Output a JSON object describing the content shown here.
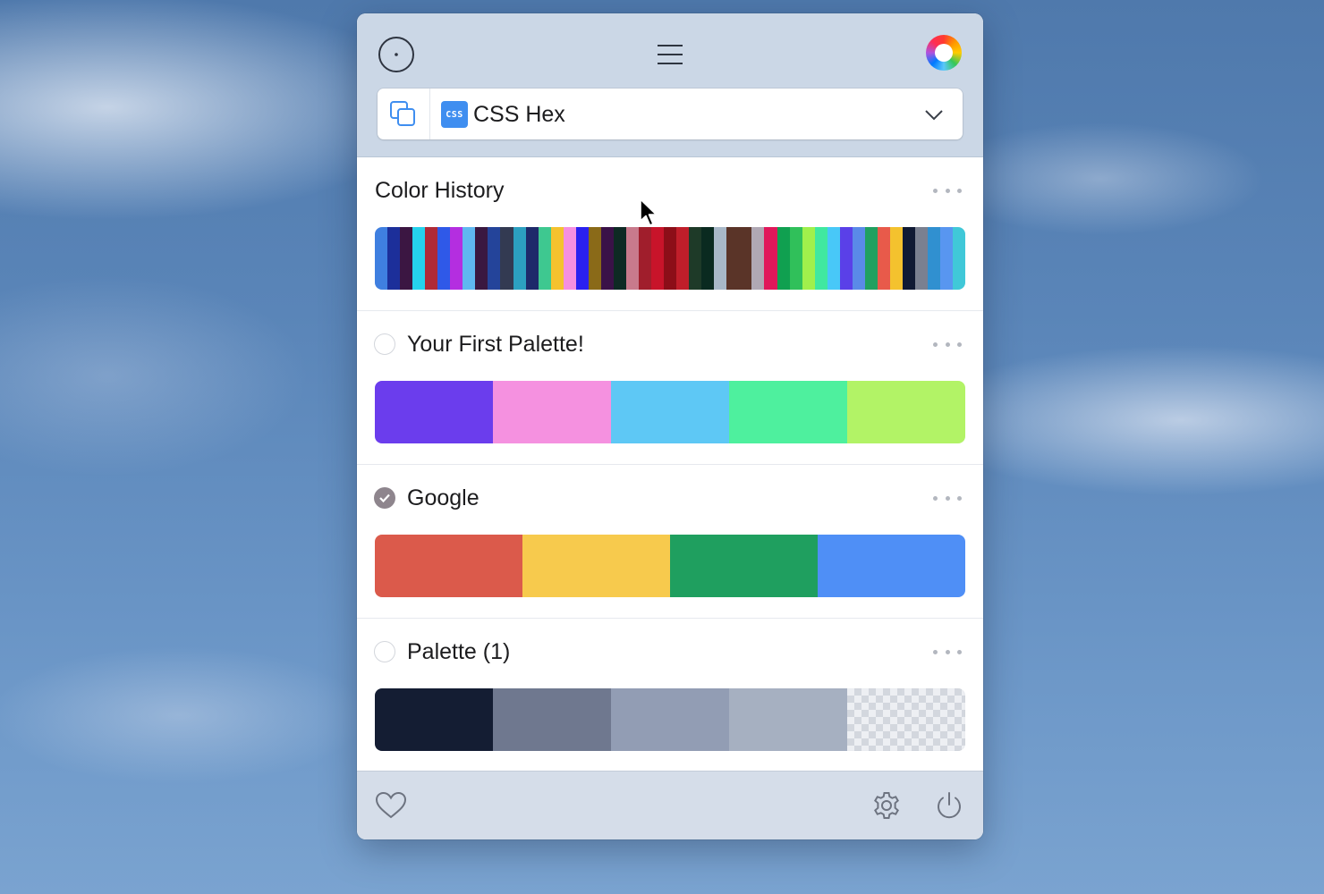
{
  "app": {
    "icons": {
      "eyedropper": "picker-target-icon",
      "menu": "hamburger-menu-icon",
      "color_wheel": "color-wheel-icon",
      "copy": "copy-icon",
      "chevron": "chevron-down-icon",
      "heart": "heart-icon",
      "settings": "gear-icon",
      "power": "power-icon"
    }
  },
  "format_selector": {
    "badge": "CSS",
    "label": "CSS Hex"
  },
  "sections": {
    "history": {
      "title": "Color History",
      "colors": [
        "#3f7fe0",
        "#1c2f9a",
        "#3b1642",
        "#25d2ec",
        "#b02a37",
        "#2f59e8",
        "#b42ee0",
        "#5fb8f0",
        "#3a1840",
        "#24449a",
        "#333a52",
        "#2ca0c0",
        "#1e2a6a",
        "#3ec890",
        "#f4c22e",
        "#f58fe0",
        "#2a20f0",
        "#8a6a18",
        "#3a1248",
        "#0e2a24",
        "#c87a8c",
        "#a01e2c",
        "#c8142a",
        "#8c0e18",
        "#c01e2a",
        "#1e3a28",
        "#0a2a20",
        "#a8b8c8",
        "#5a3428",
        "#5a3428",
        "#b0a8b4",
        "#e0185a",
        "#10a050",
        "#30c05a",
        "#a0f04c",
        "#40e8a0",
        "#48c8f8",
        "#5a40e8",
        "#5a8ae8",
        "#20a060",
        "#e85a4a",
        "#f4c22e",
        "#101a34",
        "#7a8090",
        "#3090d0",
        "#5896f0",
        "#40c8d8"
      ]
    },
    "palettes": [
      {
        "title": "Your First Palette!",
        "selected": false,
        "colors": [
          "#6b3ded",
          "#f591e0",
          "#5ec8f5",
          "#4ef09e",
          "#b2f366"
        ]
      },
      {
        "title": "Google",
        "selected": true,
        "colors": [
          "#db5a4b",
          "#f7ca4d",
          "#1f9f5f",
          "#4f8ff6"
        ]
      },
      {
        "title": "Palette (1)",
        "selected": false,
        "colors": [
          "#141d33",
          "#6f788f",
          "#929db4",
          "#a6b0c1",
          "transparent"
        ]
      }
    ]
  }
}
